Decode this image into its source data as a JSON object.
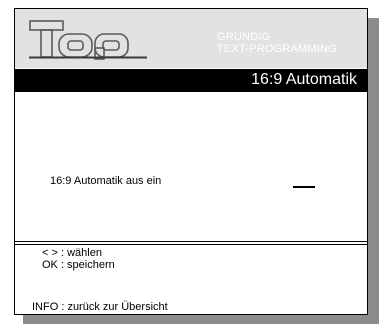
{
  "header": {
    "logo_text": "Top",
    "brand_line1": "GRUNDIG",
    "brand_line2": "TEXT-PROGRAMMING"
  },
  "title": "16:9 Automatik",
  "option": {
    "label": "16:9 Automatik aus ein",
    "value": ""
  },
  "help": {
    "select": "< > : wählen",
    "save": "OK : speichern"
  },
  "info": "INFO : zurück zur Übersicht",
  "colors": {
    "header_bg": "#e2e2e2",
    "titlebar_bg": "#000000",
    "shadow": "#8c8c8c"
  }
}
